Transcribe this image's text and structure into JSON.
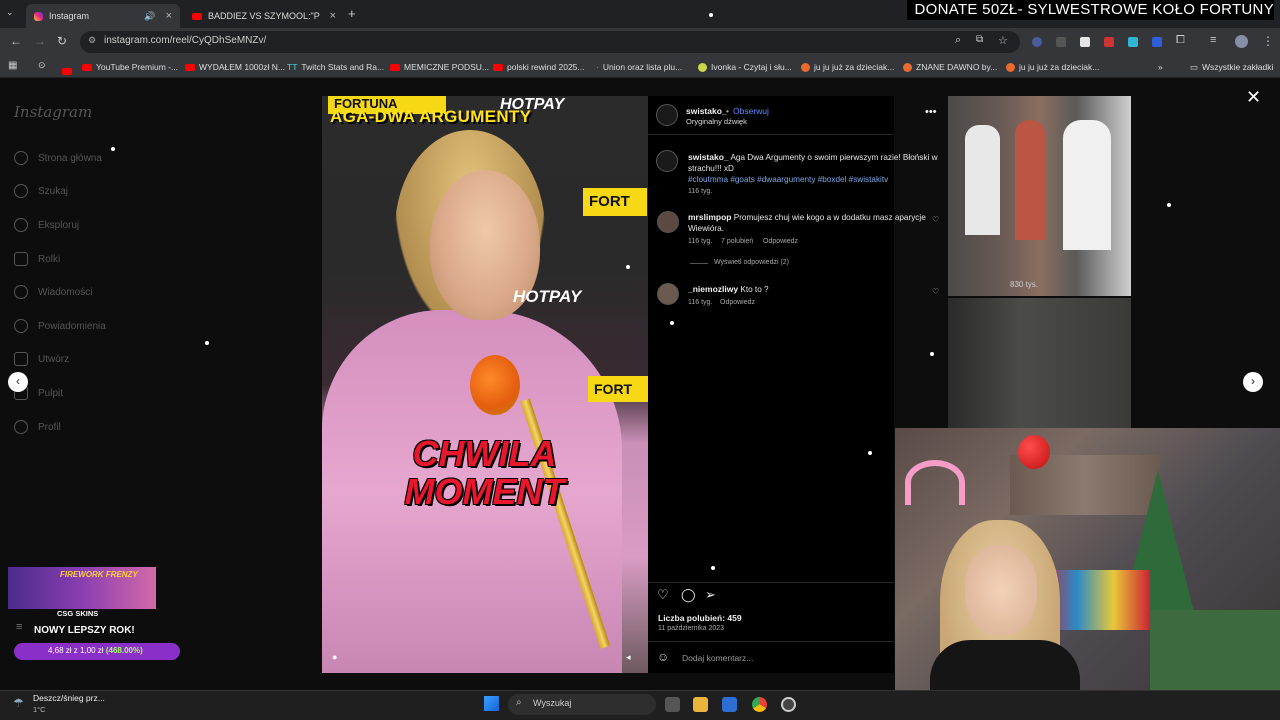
{
  "browser": {
    "tabs": [
      {
        "title": "Instagram"
      },
      {
        "title": "BADDIEZ VS SZYMOOL:\"PRZYP"
      }
    ],
    "url": "instagram.com/reel/CyQDhSeMNZv/",
    "bookmarks": [
      "YouTube Premium -...",
      "WYDAŁEM 1000zł N...",
      "Twitch Stats and Ra...",
      "MEMICZNE PODSU...",
      "polski rewind 2025...",
      "Union oraz lista plu...",
      "Ivonka - Czytaj i słu...",
      "ju ju już za dzieciak...",
      "ZNANE DAWNO by...",
      "ju ju już za dzieciak..."
    ],
    "all_bookmarks": "Wszystkie zakładki"
  },
  "stream_banner": "DONATE 50ZŁ- SYLWESTROWE KOŁO FORTUNY",
  "instagram": {
    "logo": "Instagram",
    "nav": [
      {
        "label": "Strona główna",
        "icon": "home-icon"
      },
      {
        "label": "Szukaj",
        "icon": "search-icon"
      },
      {
        "label": "Eksploruj",
        "icon": "compass-icon"
      },
      {
        "label": "Rolki",
        "icon": "reels-icon"
      },
      {
        "label": "Wiadomości",
        "icon": "messenger-icon"
      },
      {
        "label": "Powiadomienia",
        "icon": "heart-icon"
      },
      {
        "label": "Utwórz",
        "icon": "plus-icon"
      },
      {
        "label": "Pulpit",
        "icon": "dashboard-icon"
      },
      {
        "label": "Profil",
        "icon": "profile-icon"
      }
    ],
    "video": {
      "top_caption": "AGA-DWA ARGUMENTY",
      "fortuna": "FORTUNA",
      "fortuna_short": "FORT",
      "hotpay": "HOTPAY",
      "big_caption_1": "CHWILA",
      "big_caption_2": "MOMENT"
    },
    "post": {
      "author": "swistako_",
      "follow": "Obserwuj",
      "audio": "Oryginalny dźwięk",
      "caption": "Aga Dwa Argumenty o swoim pierwszym razie! Błoński w strachu!!! xD",
      "hashtags": "#cloutmma #goats #dwaargumenty #boxdel #swistakitv",
      "caption_age": "116 tyg.",
      "comments": [
        {
          "user": "mrslimpop",
          "text": "Promujesz chuj wie kogo a w dodatku masz aparycje Wiewióra.",
          "age": "116 tyg.",
          "likes": "7 polubień",
          "reply": "Odpowiedz"
        },
        {
          "user": "_niemozliwy",
          "text": "Kto to ?",
          "age": "116 tyg.",
          "reply": "Odpowiedz"
        }
      ],
      "view_replies": "Wyświetl odpowiedzi (2)",
      "likes": "Liczba polubień: 459",
      "date": "11 października 2023",
      "add_comment": "Dodaj komentarz..."
    },
    "side_views": "830 tys."
  },
  "promo": {
    "title": "FIREWORK FRENZY",
    "brand": "CSG SKINS",
    "headline": "NOWY LEPSZY ROK!",
    "price_left": "4,68 zł z 1,00 zł",
    "price_pct": "(468.00%)"
  },
  "taskbar": {
    "weather": "Deszcz/śnieg prz...",
    "temp": "1°C",
    "search": "Wyszukaj"
  }
}
